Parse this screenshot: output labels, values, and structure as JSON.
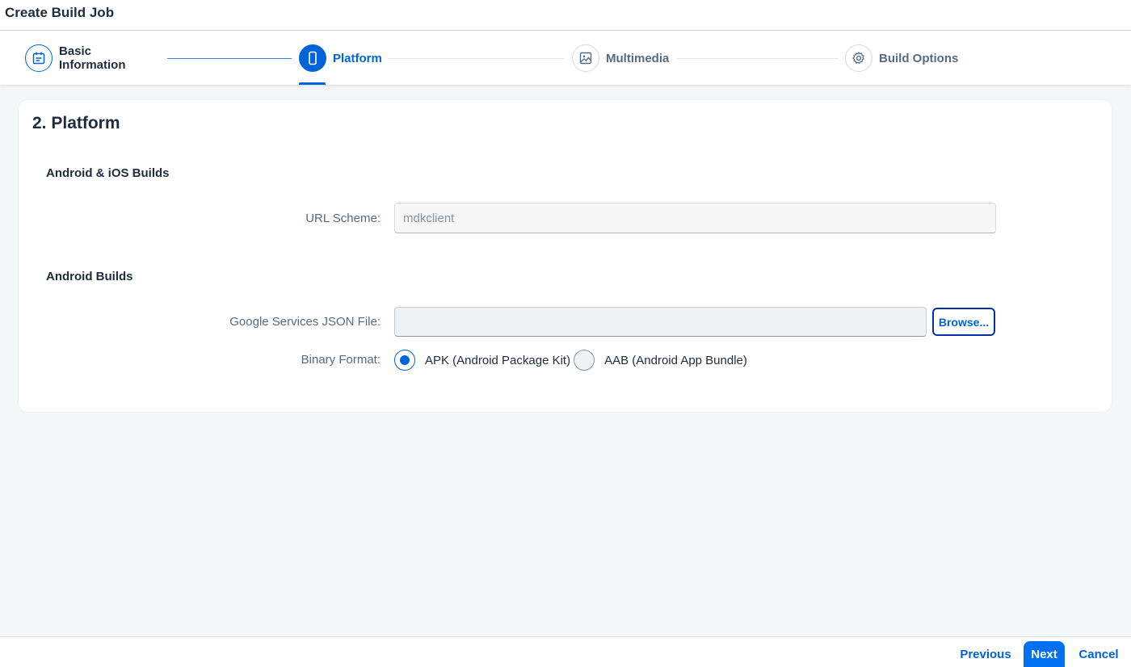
{
  "header": {
    "title": "Create Build Job"
  },
  "wizard": {
    "steps": [
      {
        "label": "Basic Information",
        "state": "done",
        "icon": "calendar-icon"
      },
      {
        "label": "Platform",
        "state": "active",
        "icon": "phone-icon"
      },
      {
        "label": "Multimedia",
        "state": "upcoming",
        "icon": "image-icon"
      },
      {
        "label": "Build Options",
        "state": "upcoming",
        "icon": "gear-icon"
      }
    ]
  },
  "main": {
    "title": "2. Platform",
    "sections": {
      "android_ios": {
        "title": "Android & iOS Builds",
        "url_scheme_label": "URL Scheme:",
        "url_scheme_value": "mdkclient"
      },
      "android": {
        "title": "Android Builds",
        "json_file_label": "Google Services JSON File:",
        "json_file_value": "",
        "browse_label": "Browse...",
        "binary_format_label": "Binary Format:",
        "options": [
          {
            "label": "APK (Android Package Kit)",
            "selected": true
          },
          {
            "label": "AAB (Android App Bundle)",
            "selected": false
          }
        ]
      }
    }
  },
  "footer": {
    "previous_label": "Previous",
    "next_label": "Next",
    "cancel_label": "Cancel"
  },
  "colors": {
    "accent": "#0064d9",
    "primary_button": "#0070f2",
    "text": "#1d2d3e",
    "muted_text": "#556b82",
    "background": "#f5f6f7"
  }
}
